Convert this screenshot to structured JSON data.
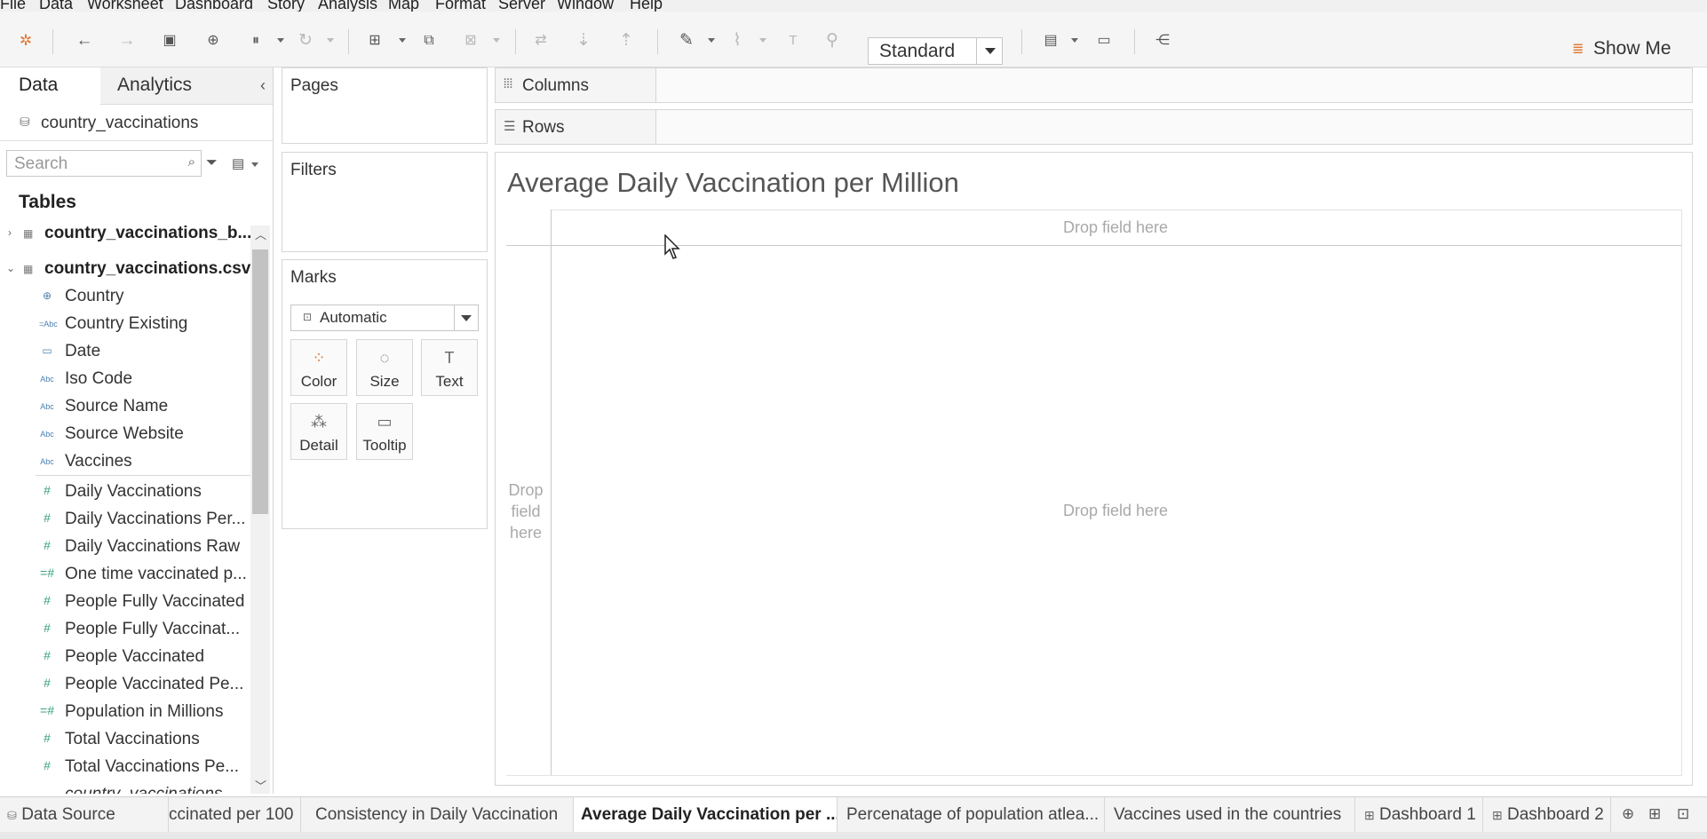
{
  "menu": [
    "File",
    "Data",
    "Worksheet",
    "Dashboard",
    "Story",
    "Analysis",
    "Map",
    "Format",
    "Server",
    "Window",
    "Help"
  ],
  "toolbar": {
    "fit_value": "Standard",
    "show_me": "Show Me"
  },
  "data_pane": {
    "tab_data": "Data",
    "tab_analytics": "Analytics",
    "datasource": "country_vaccinations",
    "search_placeholder": "Search",
    "tables_title": "Tables",
    "tables": [
      "country_vaccinations_b...",
      "country_vaccinations.csv"
    ],
    "dimensions": [
      {
        "name": "Country",
        "icon": "globe-icon"
      },
      {
        "name": "Country Existing",
        "icon": "abc-icon"
      },
      {
        "name": "Date",
        "icon": "calendar-icon"
      },
      {
        "name": "Iso Code",
        "icon": "abc-icon"
      },
      {
        "name": "Source Name",
        "icon": "abc-icon"
      },
      {
        "name": "Source Website",
        "icon": "abc-icon"
      },
      {
        "name": "Vaccines",
        "icon": "abc-icon"
      }
    ],
    "measures": [
      "Daily Vaccinations",
      "Daily Vaccinations Per...",
      "Daily Vaccinations Raw",
      "One time vaccinated p...",
      "People Fully Vaccinated",
      "People Fully Vaccinat...",
      "People Vaccinated",
      "People Vaccinated Pe...",
      "Population in Millions",
      "Total Vaccinations",
      "Total Vaccinations Pe...",
      "country_vaccinations..."
    ]
  },
  "shelves": {
    "pages": "Pages",
    "filters": "Filters",
    "marks": "Marks",
    "columns": "Columns",
    "rows": "Rows"
  },
  "marks": {
    "type": "Automatic",
    "buttons": [
      "Color",
      "Size",
      "Text",
      "Detail",
      "Tooltip"
    ]
  },
  "view": {
    "title": "Average Daily Vaccination per Million",
    "drop_top": "Drop field here",
    "drop_center": "Drop field here",
    "drop_left": "Drop field here"
  },
  "sheet_tabs": [
    "Data Source",
    "ccinated per 100",
    "Consistency in Daily Vaccination",
    "Average Daily Vaccination per ...",
    "Percenatage of population atlea...",
    "Vaccines used in the countries",
    "Dashboard 1",
    "Dashboard 2"
  ]
}
